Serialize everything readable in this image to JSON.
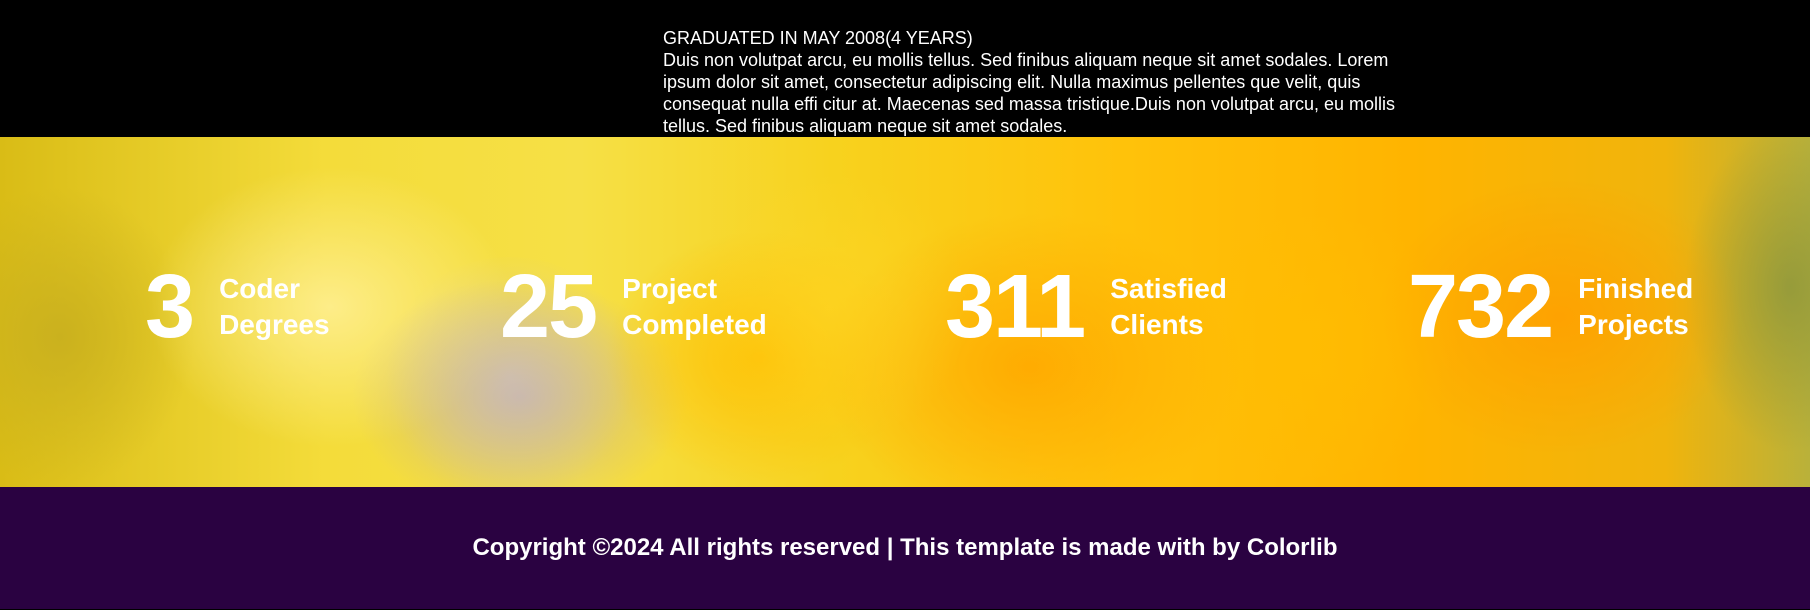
{
  "education": {
    "title": "GRADUATED IN MAY 2008(4 YEARS)",
    "body": "Duis non volutpat arcu, eu mollis tellus. Sed finibus aliquam neque sit amet sodales. Lorem ipsum dolor sit amet, consectetur adipiscing elit. Nulla maximus pellentes que velit, quis consequat nulla effi citur at. Maecenas sed massa tristique.Duis non volutpat arcu, eu mollis tellus. Sed finibus aliquam neque sit amet sodales."
  },
  "stats": [
    {
      "number": "3",
      "label_line1": "Coder",
      "label_line2": "Degrees"
    },
    {
      "number": "25",
      "label_line1": "Project",
      "label_line2": "Completed"
    },
    {
      "number": "311",
      "label_line1": "Satisfied",
      "label_line2": "Clients"
    },
    {
      "number": "732",
      "label_line1": "Finished",
      "label_line2": "Projects"
    }
  ],
  "footer": {
    "copyright": "Copyright ©2024 All rights reserved | This template is made with by Colorlib"
  },
  "colors": {
    "top_background": "#000000",
    "footer_background": "#2a0241",
    "text": "#ffffff",
    "smoke_yellow": "#ffc20a"
  }
}
